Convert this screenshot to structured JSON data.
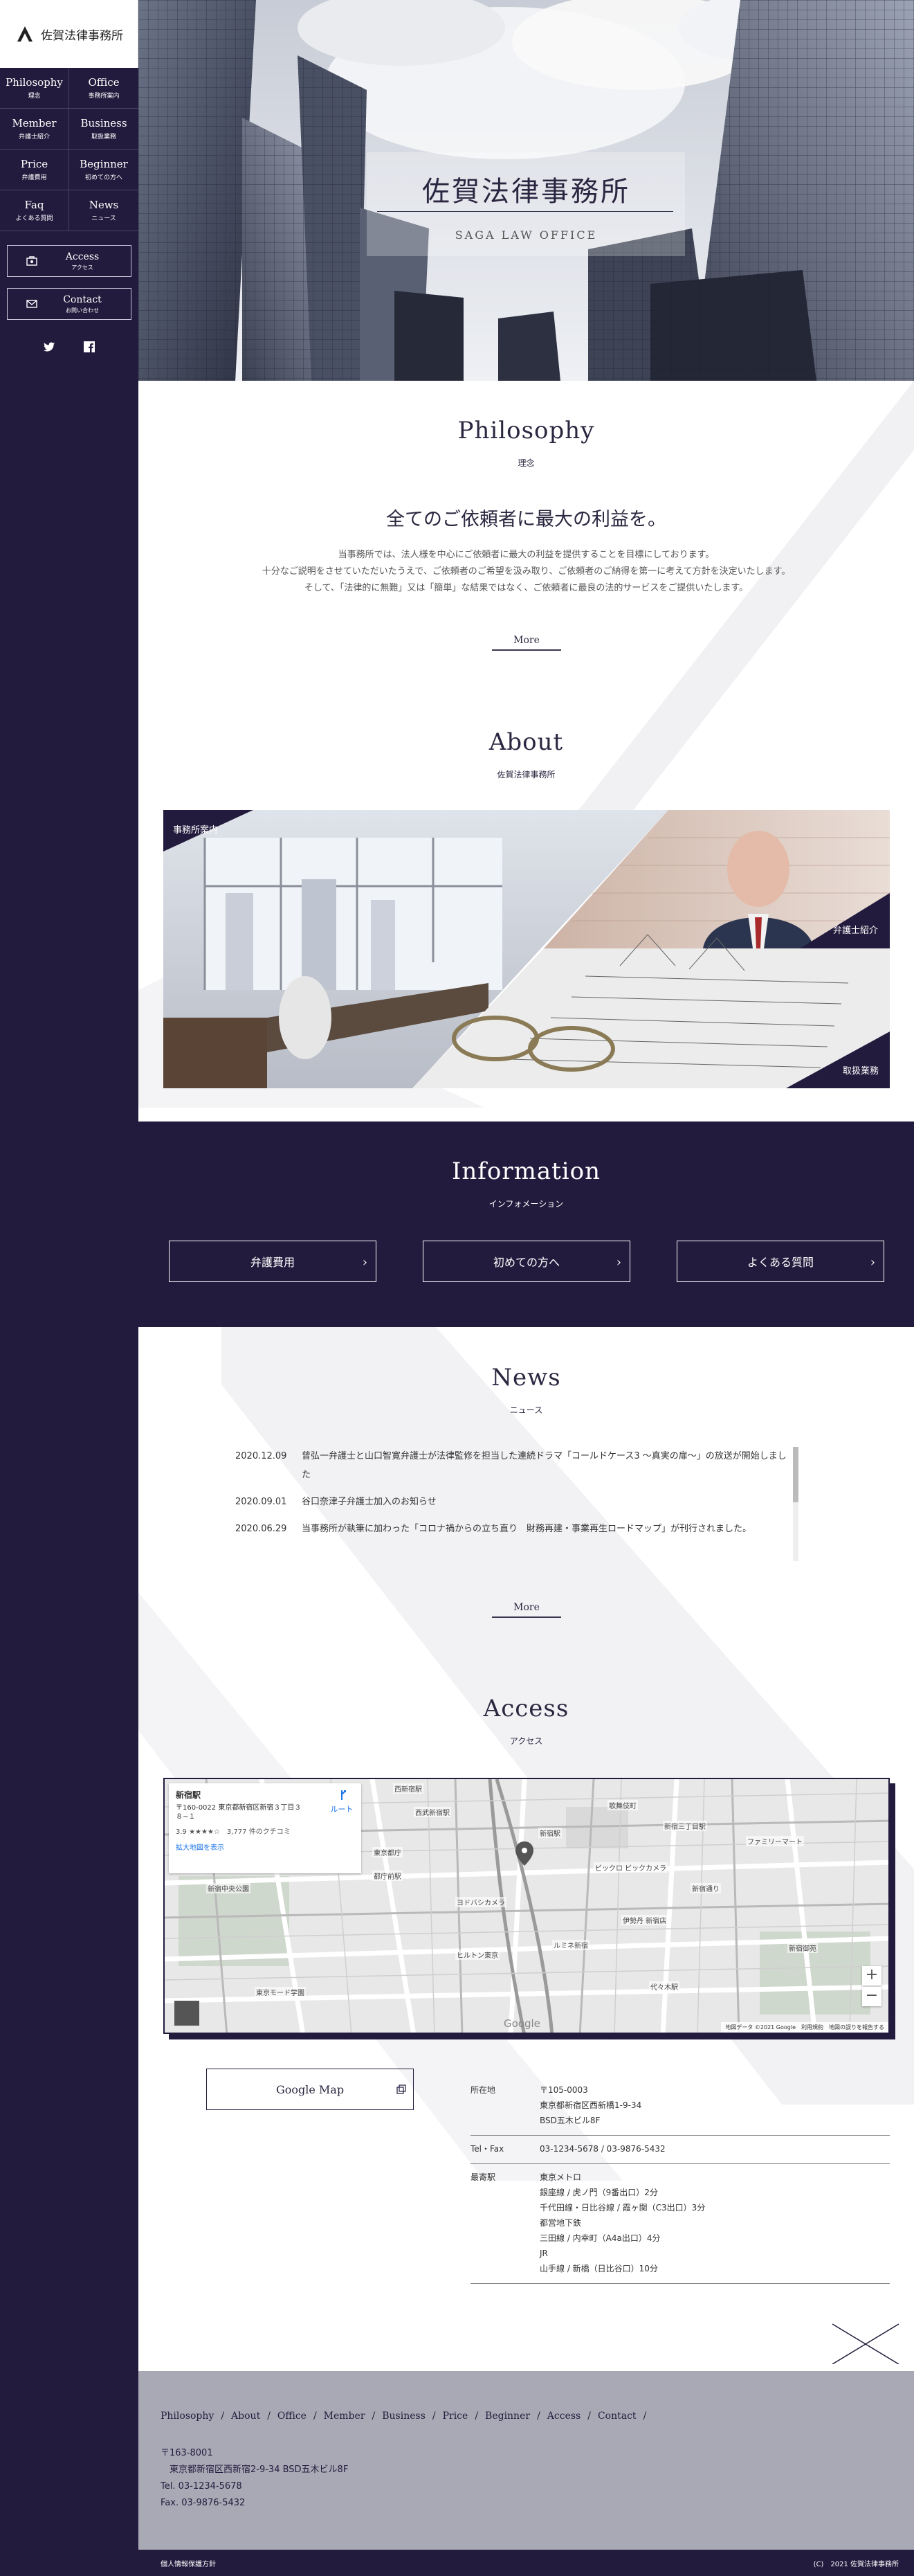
{
  "brand": {
    "name": "佐賀法律事務所"
  },
  "sidebar": {
    "nav": [
      {
        "en": "Philosophy",
        "ja": "理念"
      },
      {
        "en": "Office",
        "ja": "事務所案内"
      },
      {
        "en": "Member",
        "ja": "弁護士紹介"
      },
      {
        "en": "Business",
        "ja": "取扱業務"
      },
      {
        "en": "Price",
        "ja": "弁護費用"
      },
      {
        "en": "Beginner",
        "ja": "初めての方へ"
      },
      {
        "en": "Faq",
        "ja": "よくある質問"
      },
      {
        "en": "News",
        "ja": "ニュース"
      }
    ],
    "access": {
      "en": "Access",
      "ja": "アクセス"
    },
    "contact": {
      "en": "Contact",
      "ja": "お問い合わせ"
    },
    "social": [
      "twitter-icon",
      "facebook-icon"
    ]
  },
  "hero": {
    "title": "佐賀法律事務所",
    "subtitle": "SAGA LAW OFFICE"
  },
  "philosophy": {
    "title": "Philosophy",
    "subtitle": "理念",
    "headline": "全てのご依頼者に最大の利益を。",
    "lines": [
      "当事務所では、法人様を中心にご依頼者に最大の利益を提供することを目標にしております。",
      "十分なご説明をさせていただいたうえで、ご依頼者のご希望を汲み取り、ご依頼者のご納得を第一に考えて方針を決定いたします。",
      "そして、「法律的に無難」又は「簡単」な結果ではなく、ご依頼者に最良の法的サービスをご提供いたします。"
    ],
    "more": "More"
  },
  "about": {
    "title": "About",
    "subtitle": "佐賀法律事務所",
    "labels": {
      "office": "事務所案内",
      "member": "弁護士紹介",
      "business": "取扱業務"
    }
  },
  "information": {
    "title": "Information",
    "subtitle": "インフォメーション",
    "buttons": [
      "弁護費用",
      "初めての方へ",
      "よくある質問"
    ]
  },
  "news": {
    "title": "News",
    "subtitle": "ニュース",
    "items": [
      {
        "date": "2020.12.09",
        "text": "曾弘一弁護士と山口智寛弁護士が法律監修を担当した連続ドラマ「コールドケース3 ～真実の扉～」の放送が開始しました"
      },
      {
        "date": "2020.09.01",
        "text": "谷口奈津子弁護士加入のお知らせ"
      },
      {
        "date": "2020.06.29",
        "text": "当事務所が執筆に加わった「コロナ禍からの立ち直り　財務再建・事業再生ロードマップ」が刊行されました。"
      }
    ],
    "more": "More"
  },
  "access": {
    "title": "Access",
    "subtitle": "アクセス",
    "map": {
      "place": "新宿駅",
      "address": "〒160-0022 東京都新宿区新宿３丁目３８−１",
      "rating": "3.9 ★★★★☆　3,777 件のクチコミ",
      "enlarge": "拡大地図を表示",
      "route": "ルート",
      "footer": "地図データ ©2021 Google　利用規約　地図の誤りを報告する",
      "google": "Google",
      "zoom_in": "+",
      "zoom_out": "−",
      "labels": [
        "西新宿駅",
        "新宿駅",
        "都庁前駅",
        "東京都庁",
        "新宿中央公園",
        "ヨドバシカメラ",
        "ビックロ ビックカメラ",
        "ファミリーマート",
        "新宿御苑",
        "代々木駅",
        "ルミネ新宿",
        "新宿通り",
        "東京モード学園",
        "伊勢丹 新宿店",
        "ヒルトン東京",
        "新宿三丁目駅",
        "歌舞伎町",
        "西武新宿駅"
      ]
    },
    "gmap_button": "Google Map",
    "rows": [
      {
        "k": "所在地",
        "v": [
          "〒105-0003",
          "東京都新宿区西新橋1-9-34",
          "BSD五木ビル8F"
        ]
      },
      {
        "k": "Tel・Fax",
        "v": [
          "03-1234-5678 / 03-9876-5432"
        ]
      },
      {
        "k": "最寄駅",
        "v": [
          "東京メトロ",
          "銀座線 / 虎ノ門（9番出口）2分",
          "千代田線・日比谷線 / 霞ヶ関（C3出口）3分",
          "都営地下鉄",
          "三田線 / 内幸町（A4a出口）4分",
          "JR",
          "山手線 / 新橋（日比谷口）10分"
        ]
      }
    ]
  },
  "footer": {
    "nav": [
      "Philosophy",
      "About",
      "Office",
      "Member",
      "Business",
      "Price",
      "Beginner",
      "Access",
      "Contact"
    ],
    "address": [
      "〒163-8001",
      "　東京都新宿区西新宿2-9-34 BSD五木ビル8F",
      "Tel. 03-1234-5678",
      "Fax. 03-9876-5432"
    ],
    "privacy": "個人情報保護方針",
    "copyright": "(C)　2021 佐賀法律事務所"
  }
}
